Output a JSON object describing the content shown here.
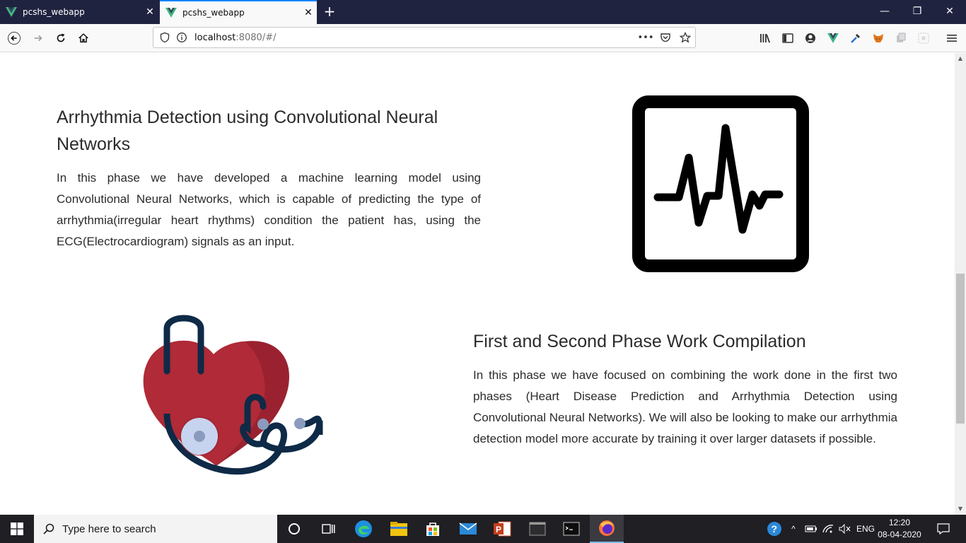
{
  "browser": {
    "tabs": [
      {
        "title": "pcshs_webapp",
        "active": false
      },
      {
        "title": "pcshs_webapp",
        "active": true
      }
    ],
    "url": {
      "host": "localhost",
      "rest": ":8080/#/"
    },
    "colors": {
      "tabstrip": "#202340",
      "active_tab_accent": "#0a84ff",
      "vue_green": "#41b883",
      "vue_dark": "#35495e"
    }
  },
  "page": {
    "sections": [
      {
        "title": "Arrhythmia Detection using Convolutional Neural Networks",
        "body": "In this phase we have developed a machine learning model using Convolutional Neural Networks, which is capable of predicting the type of arrhythmia(irregular heart rhythms) condition the patient has, using the ECG(Electrocardiogram) signals as an input.",
        "image": "ecg-monitor-icon"
      },
      {
        "title": "First and Second Phase Work Compilation",
        "body": "In this phase we have focused on combining the work done in the first two phases (Heart Disease Prediction and Arrhythmia Detection using Convolutional Neural Networks). We will also be looking to make our arrhythmia detection model more accurate by training it over larger datasets if possible.",
        "image": "heart-stethoscope-illustration"
      }
    ],
    "colors": {
      "heart": "#b02a37",
      "heart_shade": "#9a2230",
      "stethoscope": "#0e2a47",
      "chestpiece": "#c7d4f0"
    }
  },
  "taskbar": {
    "search_placeholder": "Type here to search",
    "language": "ENG",
    "time": "12:20",
    "date": "08-04-2020"
  }
}
